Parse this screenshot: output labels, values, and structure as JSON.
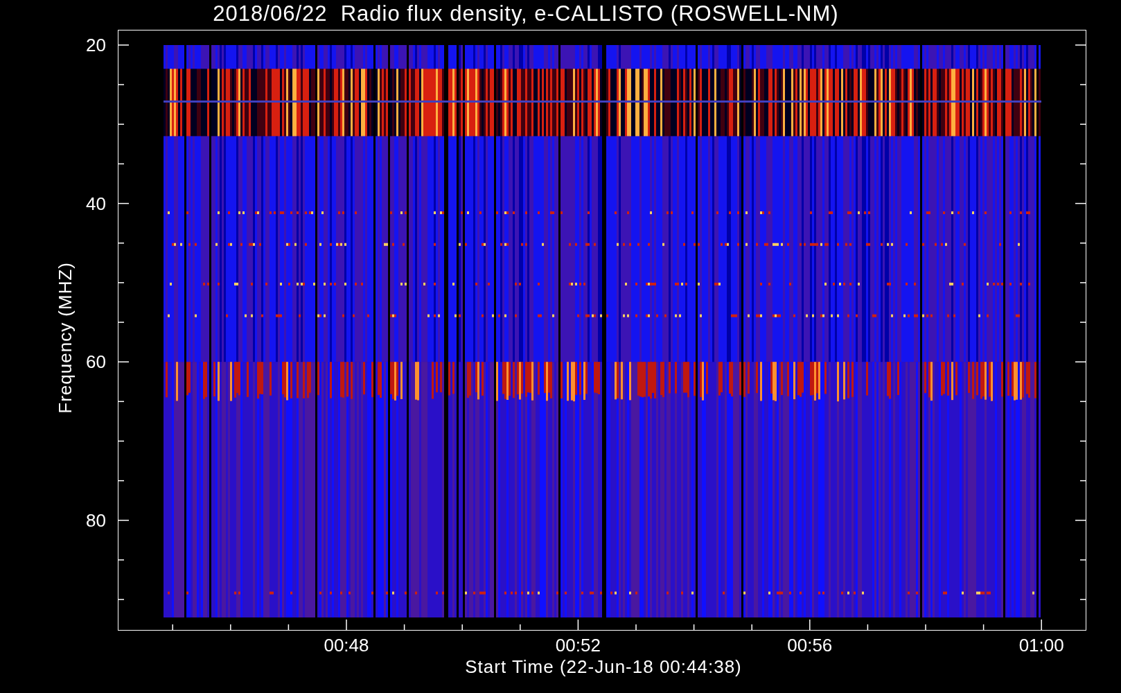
{
  "title": "2018/06/22  Radio flux density, e-CALLISTO (ROSWELL-NM)",
  "y_axis": {
    "label": "Frequency (MHZ)",
    "ticks": [
      "20",
      "40",
      "60",
      "80"
    ]
  },
  "x_axis": {
    "label": "Start Time (22-Jun-18 00:44:38)",
    "ticks": [
      "00:48",
      "00:52",
      "00:56",
      "01:00"
    ]
  }
}
